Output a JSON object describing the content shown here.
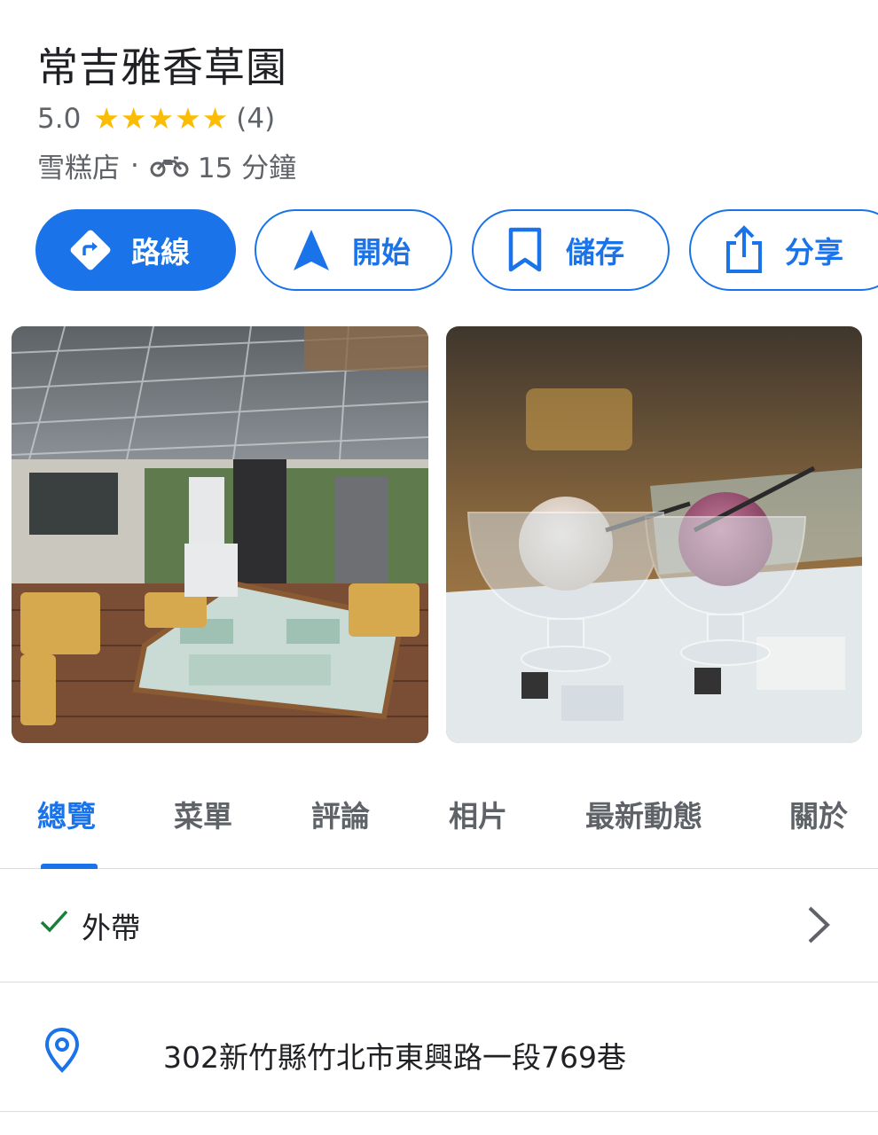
{
  "place": {
    "name": "常吉雅香草園",
    "rating": "5.0",
    "stars": 5,
    "review_count": "(4)",
    "category": "雪糕店",
    "separator": "·",
    "travel_time": "15 分鐘",
    "travel_mode_icon": "motorcycle-icon"
  },
  "actions": {
    "directions": "路線",
    "start": "開始",
    "save": "儲存",
    "share": "分享"
  },
  "photos": [
    {
      "subject": "outdoor-patio-photo"
    },
    {
      "subject": "ice-cream-cups-photo"
    }
  ],
  "tabs": [
    {
      "label": "總覽",
      "active": true
    },
    {
      "label": "菜單",
      "active": false
    },
    {
      "label": "評論",
      "active": false
    },
    {
      "label": "相片",
      "active": false
    },
    {
      "label": "最新動態",
      "active": false
    },
    {
      "label": "關於",
      "active": false
    }
  ],
  "details": {
    "takeout": "外帶",
    "address": "302新竹縣竹北市東興路一段769巷"
  },
  "colors": {
    "accent": "#1a73e8",
    "star": "#fbbc04",
    "check": "#188038",
    "secondary_text": "#5f6368"
  }
}
